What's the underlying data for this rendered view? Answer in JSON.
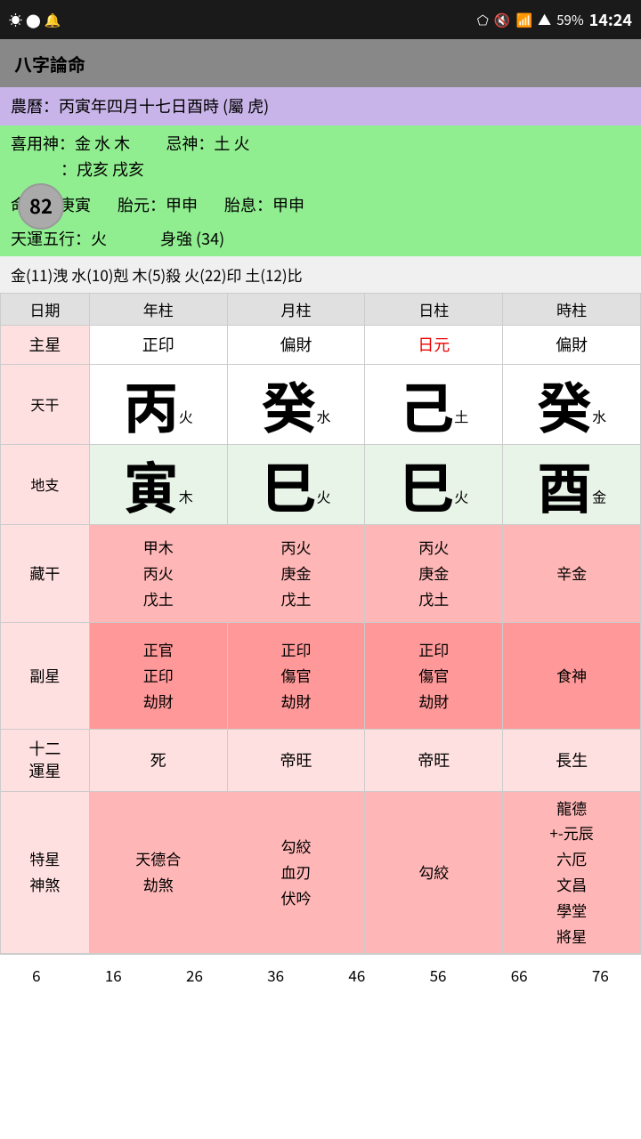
{
  "statusBar": {
    "time": "14:24",
    "battery": "59%",
    "icons": [
      "bluetooth",
      "mute",
      "wifi",
      "signal",
      "battery"
    ]
  },
  "titleBar": {
    "title": "八字論命"
  },
  "infoSection": {
    "lunar": "農曆：丙寅年四月十七日酉時 (屬 虎)"
  },
  "godSection": {
    "badge": "82",
    "xiyong": "喜用神：金 水 木",
    "jishen": "忌神：土 火",
    "line2": "：戌亥 戌亥"
  },
  "cmdSection": {
    "minggong": "命宮：庚寅",
    "taiyuan": "胎元：甲申",
    "taixi": "胎息：甲申"
  },
  "elemSection": {
    "tianyun": "天運五行：火",
    "shengqiang": "身強 (34)"
  },
  "fiveElem": {
    "text": "金(11)洩  水(10)剋  木(5)殺  火(22)印  土(12)比"
  },
  "tableHeaders": {
    "col0": "日期",
    "col1": "年柱",
    "col2": "月柱",
    "col3": "日柱",
    "col4": "時柱"
  },
  "zhuxingRow": {
    "label": "主星",
    "col1": "正印",
    "col2": "偏財",
    "col3": "日元",
    "col4": "偏財"
  },
  "tianganRow": {
    "label": "天干",
    "col1": {
      "big": "丙",
      "small": "火"
    },
    "col2": {
      "big": "癸",
      "small": "水"
    },
    "col3": {
      "big": "己",
      "small": "土"
    },
    "col4": {
      "big": "癸",
      "small": "水"
    }
  },
  "dizhiRow": {
    "label": "地支",
    "col1": {
      "big": "寅",
      "small": "木"
    },
    "col2": {
      "big": "巳",
      "small": "火"
    },
    "col3": {
      "big": "巳",
      "small": "火"
    },
    "col4": {
      "big": "酉",
      "small": "金"
    }
  },
  "cangganRow": {
    "label": "藏干",
    "col1": "甲木\n丙火\n戊土",
    "col2": "丙火\n庚金\n戊土",
    "col3": "丙火\n庚金\n戊土",
    "col4": "辛金"
  },
  "fuxingRow": {
    "label": "副星",
    "col1": "正官\n正印\n劫財",
    "col2": "正印\n傷官\n劫財",
    "col3": "正印\n傷官\n劫財",
    "col4": "食神"
  },
  "shierRow": {
    "label": "十二\n運星",
    "col1": "死",
    "col2": "帝旺",
    "col3": "帝旺",
    "col4": "長生"
  },
  "texingRow": {
    "label": "特星\n神煞",
    "col1": "天德合\n劫煞",
    "col2": "勾絞\n血刃\n伏吟",
    "col3": "勾絞",
    "col4": "龍德\n+-元辰\n六厄\n文昌\n學堂\n將星"
  },
  "bottomBar": {
    "nums": [
      "6",
      "16",
      "26",
      "36",
      "46",
      "56",
      "66",
      "76"
    ]
  }
}
